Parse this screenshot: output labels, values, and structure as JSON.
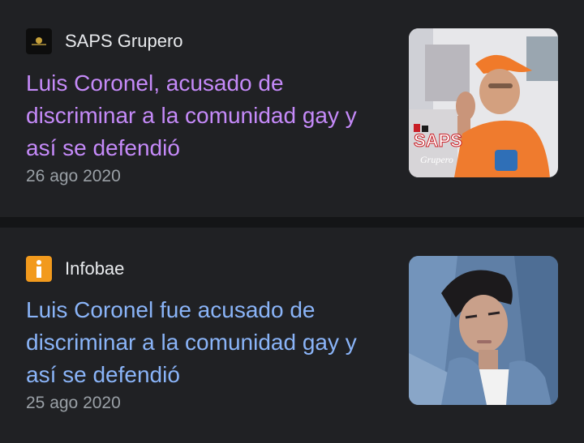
{
  "articles": [
    {
      "source": "SAPS Grupero",
      "favicon": "saps-grupero-logo-icon",
      "title": "Luis Coronel, acusado de discriminar a la comunidad gay y así se defendió",
      "date": "26 ago 2020",
      "title_color": "#c58af9",
      "thumbnail_watermark": "SAPS Grupero"
    },
    {
      "source": "Infobae",
      "favicon": "infobae-logo-icon",
      "title": "Luis Coronel fue acusado de discriminar a la comunidad gay y así se defendió",
      "date": "25 ago 2020",
      "title_color": "#8ab4f8"
    }
  ],
  "colors": {
    "background": "#202124",
    "divider": "#141517",
    "visited_link": "#c58af9",
    "link": "#8ab4f8",
    "source_text": "#e8eaed",
    "date_text": "#9aa0a6",
    "infobae_brand": "#f29a1d"
  }
}
